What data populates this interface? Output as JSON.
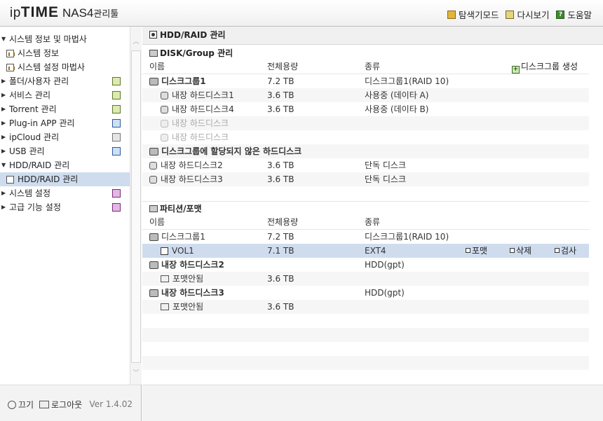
{
  "brand": {
    "ip": "ip",
    "time": "TIME",
    "nas": "NAS4",
    "gwan": "관리툴"
  },
  "toplinks": {
    "explorer": "탐색기모드",
    "refresh": "다시보기",
    "help": "도움말"
  },
  "sidebar": {
    "items": [
      {
        "label": "시스템 정보 및 마법사",
        "arrow": "▼"
      },
      {
        "label": "시스템 정보"
      },
      {
        "label": "시스템 설정 마법사"
      },
      {
        "label": "폴더/사용자 관리",
        "arrow": "▶"
      },
      {
        "label": "서비스 관리",
        "arrow": "▶"
      },
      {
        "label": "Torrent 관리",
        "arrow": "▶"
      },
      {
        "label": "Plug-in APP 관리",
        "arrow": "▶"
      },
      {
        "label": "ipCloud 관리",
        "arrow": "▶"
      },
      {
        "label": "USB 관리",
        "arrow": "▶"
      },
      {
        "label": "HDD/RAID 관리",
        "arrow": "▼"
      },
      {
        "label": "HDD/RAID 관리"
      },
      {
        "label": "시스템 설정",
        "arrow": "▶"
      },
      {
        "label": "고급 기능 설정",
        "arrow": "▶"
      }
    ],
    "footer": {
      "power": "끄기",
      "logout": "로그아웃",
      "version": "Ver 1.4.02"
    }
  },
  "main": {
    "title": "HDD/RAID 관리",
    "disk_section": {
      "title": "DISK/Group 관리",
      "headers": {
        "name": "이름",
        "capacity": "전체용량",
        "type": "종류",
        "add": "디스크그룹 생성"
      },
      "rows": [
        {
          "name": "디스크그룹1",
          "capacity": "7.2 TB",
          "type": "디스크그룹1(RAID 10)"
        },
        {
          "name": "내장 하드디스크1",
          "capacity": "3.6 TB",
          "type": "사용중 (데이타 A)"
        },
        {
          "name": "내장 하드디스크4",
          "capacity": "3.6 TB",
          "type": "사용중 (데이타 B)"
        },
        {
          "name": "내장 하드디스크"
        },
        {
          "name": "내장 하드디스크"
        },
        {
          "name": "디스크그룹에 할당되지 않은 하드디스크"
        },
        {
          "name": "내장 하드디스크2",
          "capacity": "3.6 TB",
          "type": "단독 디스크"
        },
        {
          "name": "내장 하드디스크3",
          "capacity": "3.6 TB",
          "type": "단독 디스크"
        }
      ]
    },
    "partition_section": {
      "title": "파티션/포맷",
      "headers": {
        "name": "이름",
        "capacity": "전체용량",
        "type": "종류"
      },
      "rows": [
        {
          "name": "디스크그룹1",
          "capacity": "7.2 TB",
          "type": "디스크그룹1(RAID 10)"
        },
        {
          "name": "VOL1",
          "capacity": "7.1 TB",
          "type": "EXT4",
          "actions": {
            "format": "포맷",
            "delete": "삭제",
            "check": "검사"
          }
        },
        {
          "name": "내장 하드디스크2",
          "type": "HDD(gpt)"
        },
        {
          "name": "포맷안됨",
          "capacity": "3.6 TB"
        },
        {
          "name": "내장 하드디스크3",
          "type": "HDD(gpt)"
        },
        {
          "name": "포맷안됨",
          "capacity": "3.6 TB"
        }
      ]
    }
  }
}
